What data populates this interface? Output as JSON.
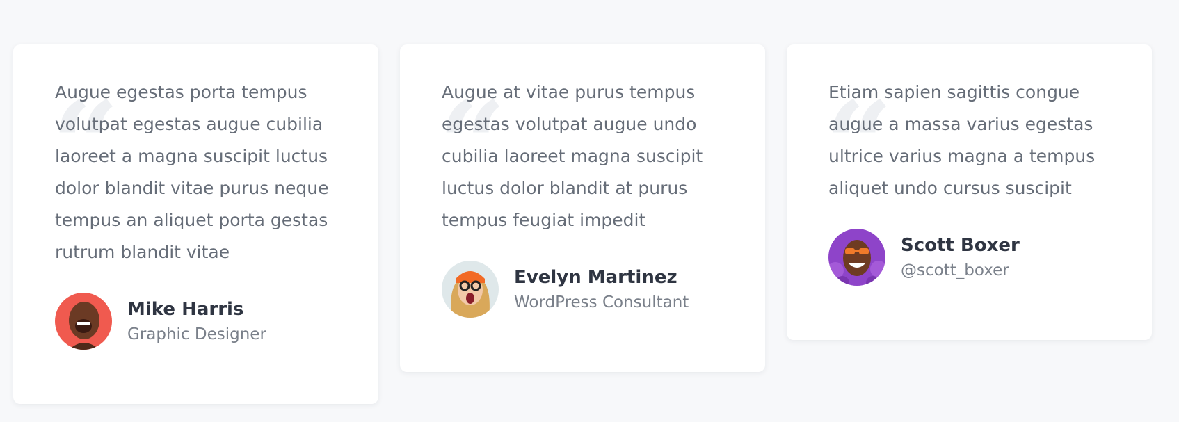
{
  "testimonials": [
    {
      "quote": "Augue egestas porta tempus volutpat egestas augue cubilia laoreet a magna suscipit luctus dolor blandit vitae purus neque tempus an aliquet porta gestas rutrum blandit vitae",
      "name": "Mike Harris",
      "role": "Graphic Designer",
      "avatar_bg": "#f05a4f"
    },
    {
      "quote": "Augue at vitae purus tempus egestas volutpat augue undo cubilia laoreet magna suscipit luctus dolor blandit at purus tempus feugiat impedit",
      "name": "Evelyn Martinez",
      "role": "WordPress Consultant",
      "avatar_bg": "#dfe8ea"
    },
    {
      "quote": "Etiam sapien sagittis congue augue a massa varius egestas ultrice varius magna a tempus aliquet undo cursus suscipit",
      "name": "Scott Boxer",
      "role": "@scott_boxer",
      "avatar_bg": "#8e44c9"
    }
  ],
  "icons": {
    "quote": "quote-icon"
  },
  "colors": {
    "page_bg": "#f7f8fa",
    "card_bg": "#ffffff",
    "text": "#666d78",
    "name": "#2f3542"
  }
}
